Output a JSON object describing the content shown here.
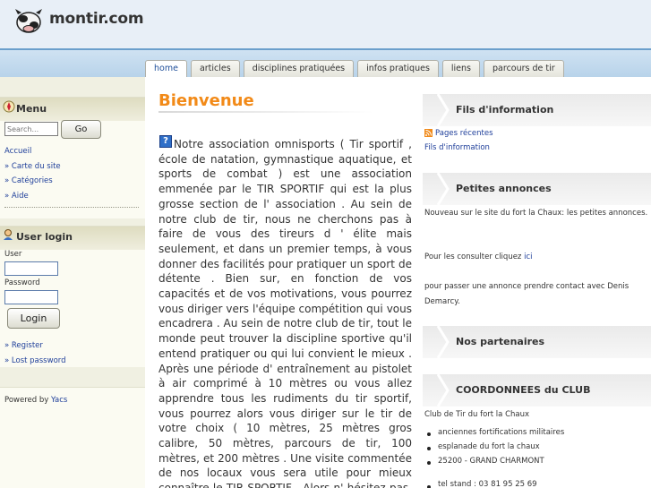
{
  "site": {
    "title": "montir.com"
  },
  "tabs": [
    "home",
    "articles",
    "disciplines pratiquées",
    "infos pratiques",
    "liens",
    "parcours de tir"
  ],
  "menu": {
    "title": "Menu",
    "search_placeholder": "Search...",
    "go_label": "Go",
    "items": [
      "Accueil",
      "» Carte du site",
      "» Catégories",
      "» Aide"
    ]
  },
  "login": {
    "title": "User login",
    "user_label": "User",
    "password_label": "Password",
    "button_label": "Login",
    "links": [
      "» Register",
      "» Lost password"
    ]
  },
  "powered": {
    "prefix": "Powered by ",
    "link": "Yacs"
  },
  "main": {
    "title": "Bienvenue",
    "body": "Notre association omnisports ( Tir sportif , école de natation, gymnastique aquatique, et sports de combat ) est une association emmenée par le TIR SPORTIF qui est la plus grosse section de l' association . Au sein de notre club de tir, nous ne cherchons pas à faire de vous des tireurs d ' élite mais seulement, et dans un premier temps, à vous donner des facilités pour pratiquer un sport de détente . Bien sur, en fonction de vos capacités et de vos motivations, vous pourrez vous diriger vers l'équipe compétition qui vous encadrera . Au sein de notre club de tir, tout le monde peut trouver la discipline sportive qu'il entend pratiquer ou qui lui convient le mieux . Après une période d' entraînement au pistolet à air comprimé à 10 mètres ou vous allez apprendre tous les rudiments du tir sportif, vous pourrez alors vous diriger sur le tir de votre choix ( 10 mètres, 25 mètres gros calibre, 50 mètres, parcours de tir, 100 mètres, et 200 mètres . Une visite commentée de nos locaux vous sera utile pour mieux connaître le TIR SPORTIF . Alors n' hésitez pas, rendez nous une visite au Fort la"
  },
  "right": {
    "fils_title": "Fils d'information",
    "fils_links": [
      "Pages récentes",
      "Fils d'information"
    ],
    "annonces_title": "Petites annonces",
    "annonces_text1": "Nouveau sur le site du fort la Chaux: les petites annonces.",
    "annonces_text2_prefix": "Pour les consulter cliquez ",
    "annonces_text2_link": "ici",
    "annonces_text3": "pour passer une annonce prendre contact avec Denis Demarcy.",
    "partenaires_title": "Nos partenaires",
    "coord_title": "COORDONNEES du CLUB",
    "coord_name": "Club de Tir du fort la Chaux",
    "coord_items": [
      "anciennes fortifications militaires",
      "esplanade du fort la chaux",
      "25200 - GRAND CHARMONT",
      "tel stand : 03 81 95 25 69"
    ]
  },
  "colors": {
    "accent": "#f28a18",
    "link": "#1f3f9a",
    "tab_bar": "#b8d3ea"
  }
}
